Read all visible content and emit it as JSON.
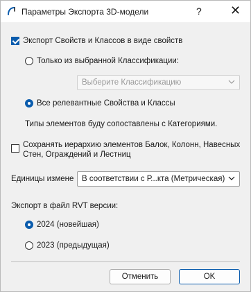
{
  "window": {
    "title": "Параметры Экспорта 3D-модели",
    "help_label": "?",
    "close_label": "✕"
  },
  "export_props": {
    "label": "Экспорт Свойств и Классов в виде свойств",
    "checked": true
  },
  "only_selected": {
    "label": "Только из выбранной Классификации:",
    "checked": false
  },
  "classification_select": {
    "value": "Выберите Классификацию",
    "disabled": true
  },
  "all_relevant": {
    "label": "Все релевантные Свойства и Классы",
    "checked": true
  },
  "info_text": "Типы элементов буду сопоставлены с Категориями.",
  "keep_hierarchy": {
    "line1": "Сохранять иерархию элементов Балок, Колонн, Навесных",
    "line2": "Стен, Ограждений и Лестниц",
    "checked": false
  },
  "units": {
    "label": "Единицы измене",
    "value": "В соответствии с Р...кта (Метрическая)"
  },
  "rvt_version": {
    "label": "Экспорт в файл RVT версии:",
    "options": [
      {
        "label": "2024 (новейшая)",
        "checked": true
      },
      {
        "label": "2023 (предыдущая)",
        "checked": false
      }
    ]
  },
  "buttons": {
    "cancel": "Отменить",
    "ok": "OK"
  },
  "colors": {
    "accent": "#0b5cad",
    "background": "#f0f0f0"
  }
}
